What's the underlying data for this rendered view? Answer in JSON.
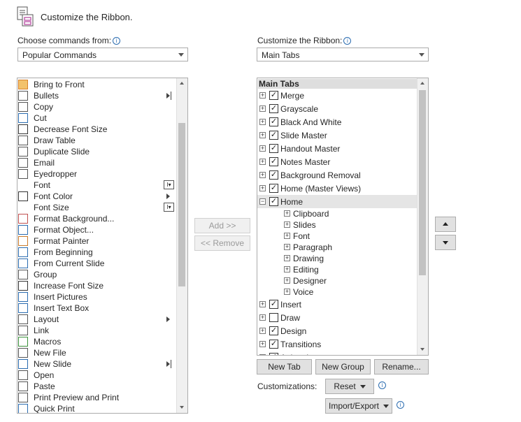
{
  "header": {
    "title": "Customize the Ribbon.",
    "icon": "customize-ribbon-icon"
  },
  "left": {
    "label": "Choose commands from:",
    "combo_value": "Popular Commands",
    "commands": [
      {
        "label": "Bring to Front",
        "icon": "bring-to-front-icon"
      },
      {
        "label": "Bullets",
        "icon": "bullets-icon",
        "sub": true
      },
      {
        "label": "Copy",
        "icon": "copy-icon"
      },
      {
        "label": "Cut",
        "icon": "cut-icon"
      },
      {
        "label": "Decrease Font Size",
        "icon": "decrease-font-size-icon"
      },
      {
        "label": "Draw Table",
        "icon": "draw-table-icon"
      },
      {
        "label": "Duplicate Slide",
        "icon": "duplicate-slide-icon"
      },
      {
        "label": "Email",
        "icon": "email-icon"
      },
      {
        "label": "Eyedropper",
        "icon": "eyedropper-icon"
      },
      {
        "label": "Font",
        "icon": "",
        "drop": true
      },
      {
        "label": "Font Color",
        "icon": "font-color-icon",
        "sub": true
      },
      {
        "label": "Font Size",
        "icon": "",
        "drop": true
      },
      {
        "label": "Format Background...",
        "icon": "format-background-icon"
      },
      {
        "label": "Format Object...",
        "icon": "format-object-icon"
      },
      {
        "label": "Format Painter",
        "icon": "format-painter-icon"
      },
      {
        "label": "From Beginning",
        "icon": "from-beginning-icon"
      },
      {
        "label": "From Current Slide",
        "icon": "from-current-slide-icon"
      },
      {
        "label": "Group",
        "icon": "group-icon"
      },
      {
        "label": "Increase Font Size",
        "icon": "increase-font-size-icon"
      },
      {
        "label": "Insert Pictures",
        "icon": "insert-pictures-icon"
      },
      {
        "label": "Insert Text Box",
        "icon": "insert-text-box-icon"
      },
      {
        "label": "Layout",
        "icon": "layout-icon",
        "sub": true
      },
      {
        "label": "Link",
        "icon": "link-icon"
      },
      {
        "label": "Macros",
        "icon": "macros-icon"
      },
      {
        "label": "New File",
        "icon": "new-file-icon"
      },
      {
        "label": "New Slide",
        "icon": "new-slide-icon",
        "sub": true
      },
      {
        "label": "Open",
        "icon": "open-icon"
      },
      {
        "label": "Paste",
        "icon": "paste-icon"
      },
      {
        "label": "Print Preview and Print",
        "icon": "print-preview-icon"
      },
      {
        "label": "Quick Print",
        "icon": "quick-print-icon"
      }
    ]
  },
  "middle": {
    "add_label": "Add >>",
    "remove_label": "<< Remove"
  },
  "right": {
    "label": "Customize the Ribbon:",
    "combo_value": "Main Tabs",
    "tree_header": "Main Tabs",
    "tabs": [
      {
        "label": "Merge",
        "checked": true,
        "expanded": false,
        "level": 0
      },
      {
        "label": "Grayscale",
        "checked": true,
        "expanded": false,
        "level": 0
      },
      {
        "label": "Black And White",
        "checked": true,
        "expanded": false,
        "level": 0
      },
      {
        "label": "Slide Master",
        "checked": true,
        "expanded": false,
        "level": 0
      },
      {
        "label": "Handout Master",
        "checked": true,
        "expanded": false,
        "level": 0
      },
      {
        "label": "Notes Master",
        "checked": true,
        "expanded": false,
        "level": 0
      },
      {
        "label": "Background Removal",
        "checked": true,
        "expanded": false,
        "level": 0
      },
      {
        "label": "Home (Master Views)",
        "checked": true,
        "expanded": false,
        "level": 0
      },
      {
        "label": "Home",
        "checked": true,
        "expanded": true,
        "level": 0,
        "selected": true
      },
      {
        "label": "Clipboard",
        "level": 1
      },
      {
        "label": "Slides",
        "level": 1
      },
      {
        "label": "Font",
        "level": 1
      },
      {
        "label": "Paragraph",
        "level": 1
      },
      {
        "label": "Drawing",
        "level": 1
      },
      {
        "label": "Editing",
        "level": 1
      },
      {
        "label": "Designer",
        "level": 1
      },
      {
        "label": "Voice",
        "level": 1
      },
      {
        "label": "Insert",
        "checked": true,
        "expanded": false,
        "level": 0
      },
      {
        "label": "Draw",
        "checked": false,
        "expanded": false,
        "level": 0
      },
      {
        "label": "Design",
        "checked": true,
        "expanded": false,
        "level": 0
      },
      {
        "label": "Transitions",
        "checked": true,
        "expanded": false,
        "level": 0
      },
      {
        "label": "Animations",
        "checked": true,
        "expanded": false,
        "level": 0
      }
    ],
    "new_tab_label": "New Tab",
    "new_group_label": "New Group",
    "rename_label": "Rename...",
    "customizations_label": "Customizations:",
    "reset_label": "Reset",
    "import_export_label": "Import/Export"
  },
  "colors": {
    "accent": "#2b6cb0",
    "selected_row": "#e5e5e5",
    "button_bg": "#e1e1e1"
  }
}
